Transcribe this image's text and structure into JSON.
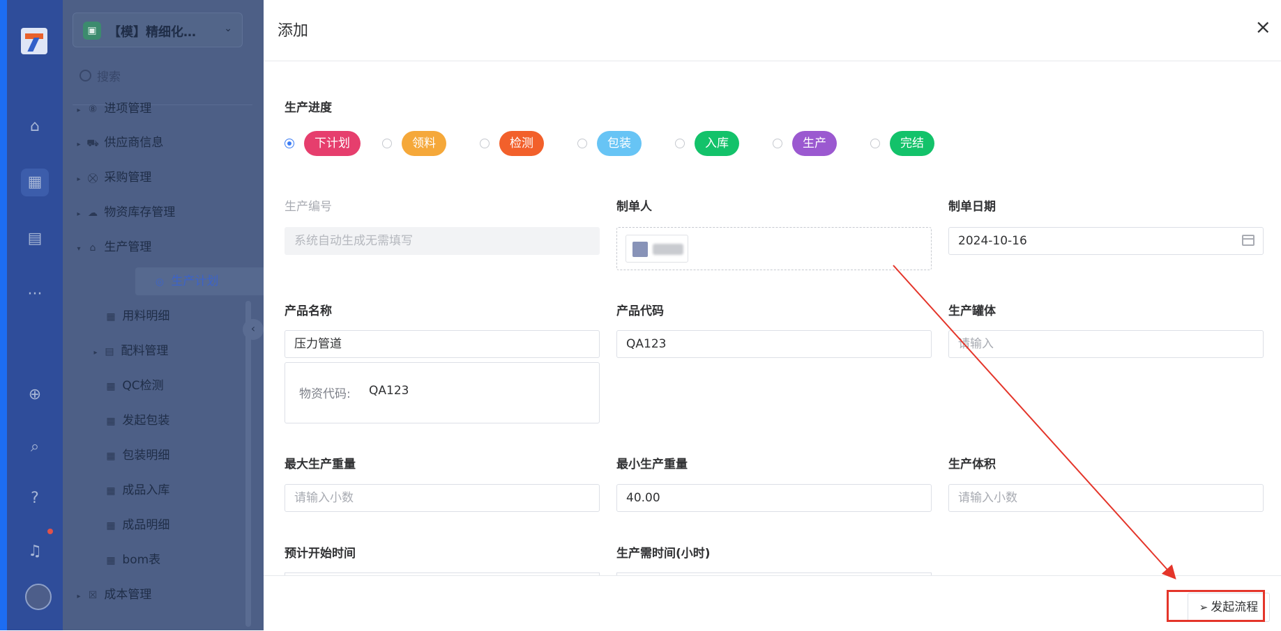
{
  "rail": {
    "icons": [
      "logo-icon",
      "home-icon",
      "grid-icon",
      "document-icon",
      "more-icon",
      "plus-circle-icon",
      "search-icon",
      "help-icon",
      "bell-icon"
    ]
  },
  "menu": {
    "app_name": "【模】精细化…",
    "search_placeholder": "搜索",
    "items": [
      {
        "label": "进项管理",
        "icon": "money-icon",
        "expand": "▸"
      },
      {
        "label": "供应商信息",
        "icon": "truck-icon",
        "expand": "▸"
      },
      {
        "label": "采购管理",
        "icon": "cart-icon",
        "expand": "▸"
      },
      {
        "label": "物资库存管理",
        "icon": "cloud-icon",
        "expand": "▸"
      },
      {
        "label": "生产管理",
        "icon": "factory-icon",
        "expand": "▾"
      },
      {
        "label": "生产计划",
        "icon": "planet-icon"
      },
      {
        "label": "用料明细",
        "icon": "grid-icon"
      },
      {
        "label": "配料管理",
        "icon": "doc-icon",
        "expand": "▸"
      },
      {
        "label": "QC检测",
        "icon": "grid-icon"
      },
      {
        "label": "发起包装",
        "icon": "grid-icon"
      },
      {
        "label": "包装明细",
        "icon": "grid-icon"
      },
      {
        "label": "成品入库",
        "icon": "grid-icon"
      },
      {
        "label": "成品明细",
        "icon": "grid-icon"
      },
      {
        "label": "bom表",
        "icon": "grid-icon"
      },
      {
        "label": "成本管理",
        "icon": "money-box-icon",
        "expand": "▸"
      }
    ]
  },
  "drawer": {
    "title": "添加",
    "close": "×",
    "progress": {
      "label": "生产进度",
      "selected": "下计划",
      "options": [
        {
          "label": "下计划",
          "color": "#e63e6d"
        },
        {
          "label": "领料",
          "color": "#f5a83a"
        },
        {
          "label": "检测",
          "color": "#f2602b"
        },
        {
          "label": "包装",
          "color": "#67c4f5"
        },
        {
          "label": "入库",
          "color": "#13c26a"
        },
        {
          "label": "生产",
          "color": "#9b59d0"
        },
        {
          "label": "完结",
          "color": "#13c26a"
        }
      ]
    },
    "fields": {
      "code": {
        "label": "生产编号",
        "placeholder": "系统自动生成无需填写"
      },
      "creator": {
        "label": "制单人"
      },
      "date": {
        "label": "制单日期",
        "value": "2024-10-16"
      },
      "product_name": {
        "label": "产品名称",
        "value": "压力管道"
      },
      "product_info": {
        "label": "物资代码:",
        "value": "QA123"
      },
      "product_code": {
        "label": "产品代码",
        "value": "QA123"
      },
      "tank": {
        "label": "生产罐体",
        "placeholder": "请输入"
      },
      "max_weight": {
        "label": "最大生产重量",
        "placeholder": "请输入小数"
      },
      "min_weight": {
        "label": "最小生产重量",
        "value": "40.00"
      },
      "volume": {
        "label": "生产体积",
        "placeholder": "请输入小数"
      },
      "start_time": {
        "label": "预计开始时间"
      },
      "hours": {
        "label": "生产需时间(小时)"
      }
    },
    "submit_label": "发起流程"
  }
}
